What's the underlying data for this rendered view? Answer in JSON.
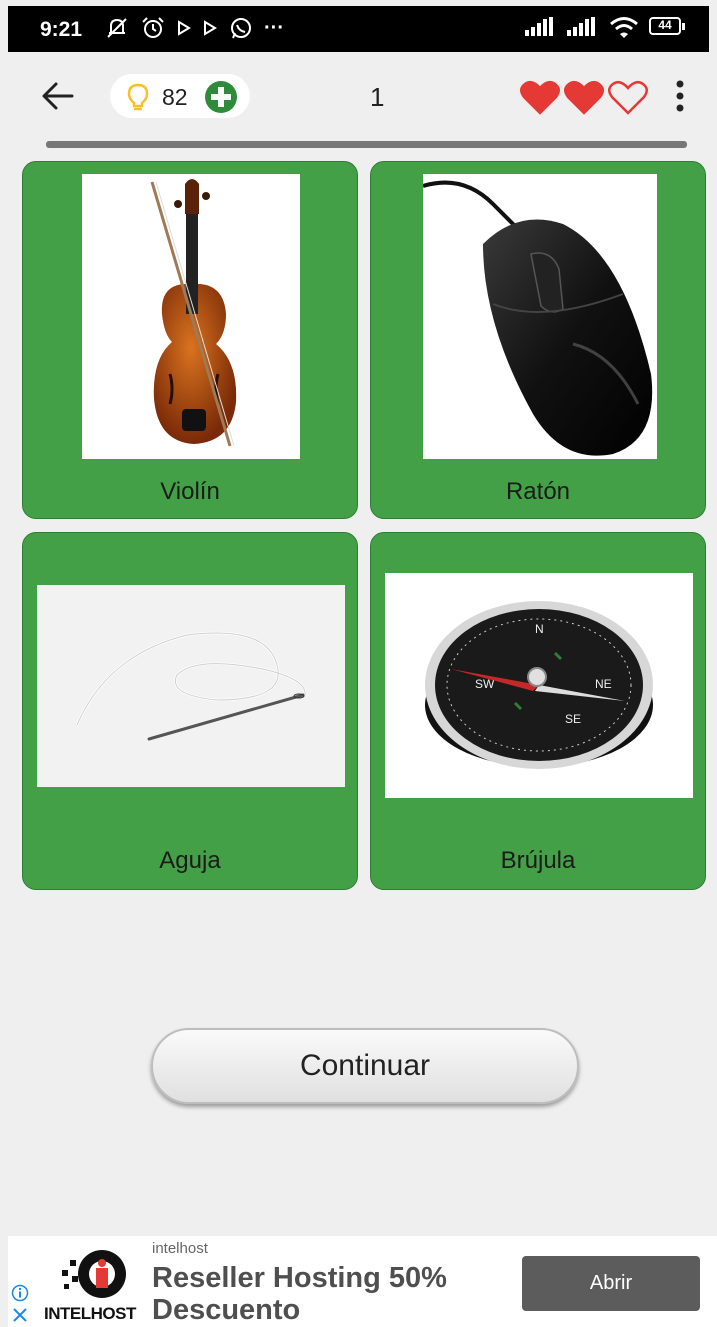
{
  "status_bar": {
    "time": "9:21",
    "battery": "44",
    "more": "···"
  },
  "header": {
    "hint_count": "82",
    "level": "1",
    "hearts": {
      "total": 3,
      "filled": 2
    }
  },
  "progress": {
    "fraction": 0
  },
  "options": [
    {
      "label": "Violín",
      "image": "violin"
    },
    {
      "label": "Ratón",
      "image": "computer-mouse"
    },
    {
      "label": "Aguja",
      "image": "needle-and-thread"
    },
    {
      "label": "Brújula",
      "image": "compass"
    }
  ],
  "continue_label": "Continuar",
  "ad": {
    "brand": "intelhost",
    "headline": "Reseller Hosting 50% Descuento",
    "cta": "Abrir",
    "logo_text": "INTELHOST"
  },
  "colors": {
    "card_green": "#43a047",
    "heart_red": "#e53935",
    "bulb_yellow": "#f9c02b",
    "plus_green": "#2e8b3a"
  }
}
